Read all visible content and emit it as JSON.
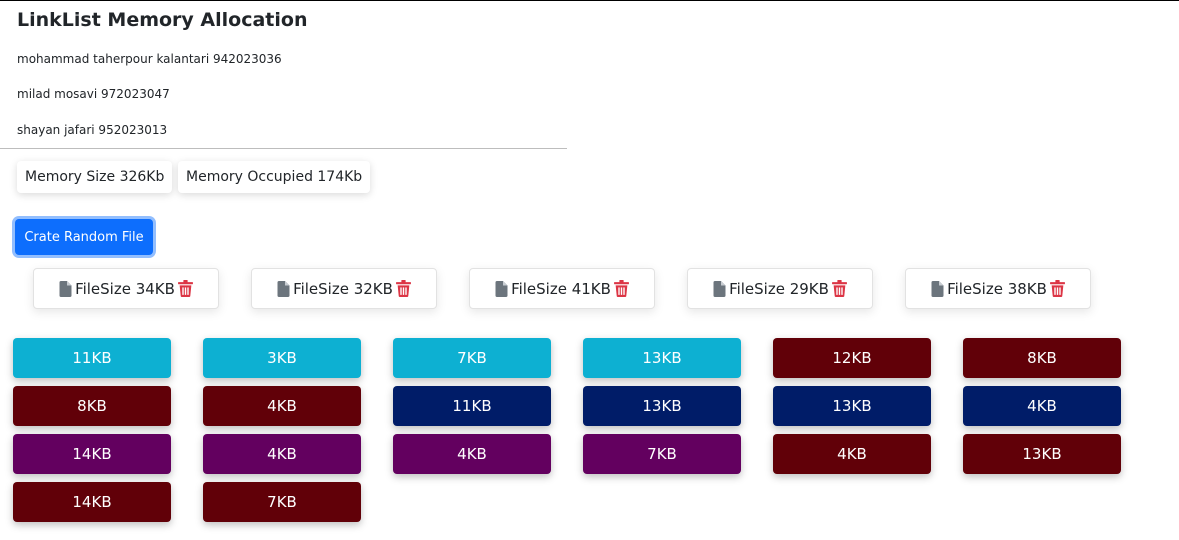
{
  "header": {
    "title": "LinkList Memory Allocation",
    "authors": [
      "mohammad taherpour kalantari 942023036",
      "milad mosavi 972023047",
      "shayan jafari 952023013"
    ]
  },
  "stats": {
    "memory_size": "Memory Size 326Kb",
    "memory_occupied": "Memory Occupied 174Kb"
  },
  "actions": {
    "create_label": "Crate Random File"
  },
  "files": [
    {
      "label": "FileSize 34KB",
      "icon": "file-icon",
      "delete_icon": "trash-icon"
    },
    {
      "label": "FileSize 32KB",
      "icon": "file-icon",
      "delete_icon": "trash-icon"
    },
    {
      "label": "FileSize 41KB",
      "icon": "file-icon",
      "delete_icon": "trash-icon"
    },
    {
      "label": "FileSize 29KB",
      "icon": "file-icon",
      "delete_icon": "trash-icon"
    },
    {
      "label": "FileSize 38KB",
      "icon": "file-icon",
      "delete_icon": "trash-icon"
    }
  ],
  "colors": {
    "free": "#0db0d2",
    "file_a": "#610008",
    "file_b": "#001c68",
    "file_c": "#63005f",
    "primary": "#0d6efd",
    "trash": "#dc3545"
  },
  "memory_columns": [
    [
      {
        "label": "11KB",
        "color": "#0db0d2"
      },
      {
        "label": "8KB",
        "color": "#610008"
      },
      {
        "label": "14KB",
        "color": "#63005f"
      },
      {
        "label": "14KB",
        "color": "#610008"
      }
    ],
    [
      {
        "label": "3KB",
        "color": "#0db0d2"
      },
      {
        "label": "4KB",
        "color": "#610008"
      },
      {
        "label": "4KB",
        "color": "#63005f"
      },
      {
        "label": "7KB",
        "color": "#610008"
      }
    ],
    [
      {
        "label": "7KB",
        "color": "#0db0d2"
      },
      {
        "label": "11KB",
        "color": "#001c68"
      },
      {
        "label": "4KB",
        "color": "#63005f"
      }
    ],
    [
      {
        "label": "13KB",
        "color": "#0db0d2"
      },
      {
        "label": "13KB",
        "color": "#001c68"
      },
      {
        "label": "7KB",
        "color": "#63005f"
      }
    ],
    [
      {
        "label": "12KB",
        "color": "#610008"
      },
      {
        "label": "13KB",
        "color": "#001c68"
      },
      {
        "label": "4KB",
        "color": "#610008"
      }
    ],
    [
      {
        "label": "8KB",
        "color": "#610008"
      },
      {
        "label": "4KB",
        "color": "#001c68"
      },
      {
        "label": "13KB",
        "color": "#610008"
      }
    ]
  ]
}
